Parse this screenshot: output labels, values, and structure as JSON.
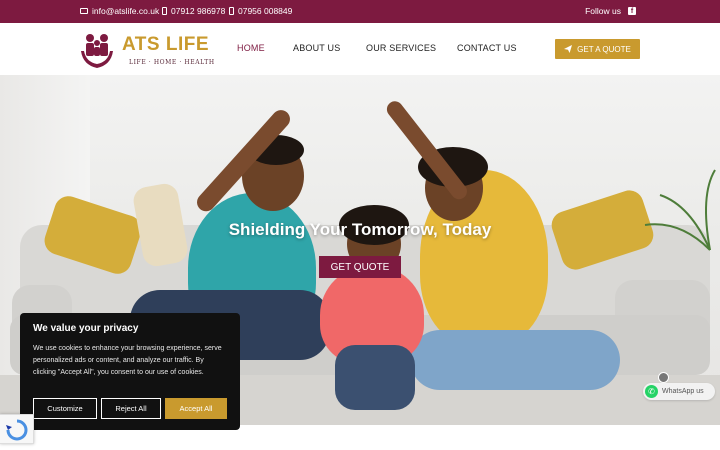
{
  "topbar": {
    "email": "info@atslife.co.uk",
    "phone1": "07912 986978",
    "phone2": "07956 008849",
    "follow_label": "Follow us",
    "social_icon": "facebook-icon"
  },
  "header": {
    "logo_title": "ATS LIFE",
    "logo_tagline": "LIFE · HOME · HEALTH",
    "nav": [
      {
        "label": "HOME",
        "active": true
      },
      {
        "label": "ABOUT US",
        "active": false
      },
      {
        "label": "OUR SERVICES",
        "active": false
      },
      {
        "label": "CONTACT US",
        "active": false
      }
    ],
    "cta_label": "GET A QUOTE",
    "cta_icon": "paper-plane-icon"
  },
  "hero": {
    "title": "Shielding Your Tomorrow, Today",
    "button_label": "GET QUOTE"
  },
  "cookie_banner": {
    "title": "We value your privacy",
    "text": "We use cookies to enhance your browsing experience, serve personalized ads or content, and analyze our traffic. By clicking \"Accept All\", you consent to our use of cookies.",
    "customize_label": "Customize",
    "reject_label": "Reject All",
    "accept_label": "Accept All"
  },
  "whatsapp": {
    "label": "WhatsApp us"
  },
  "colors": {
    "brand": "#7d1a40",
    "accent": "#c99a2e",
    "cookie_bg": "#111111"
  }
}
